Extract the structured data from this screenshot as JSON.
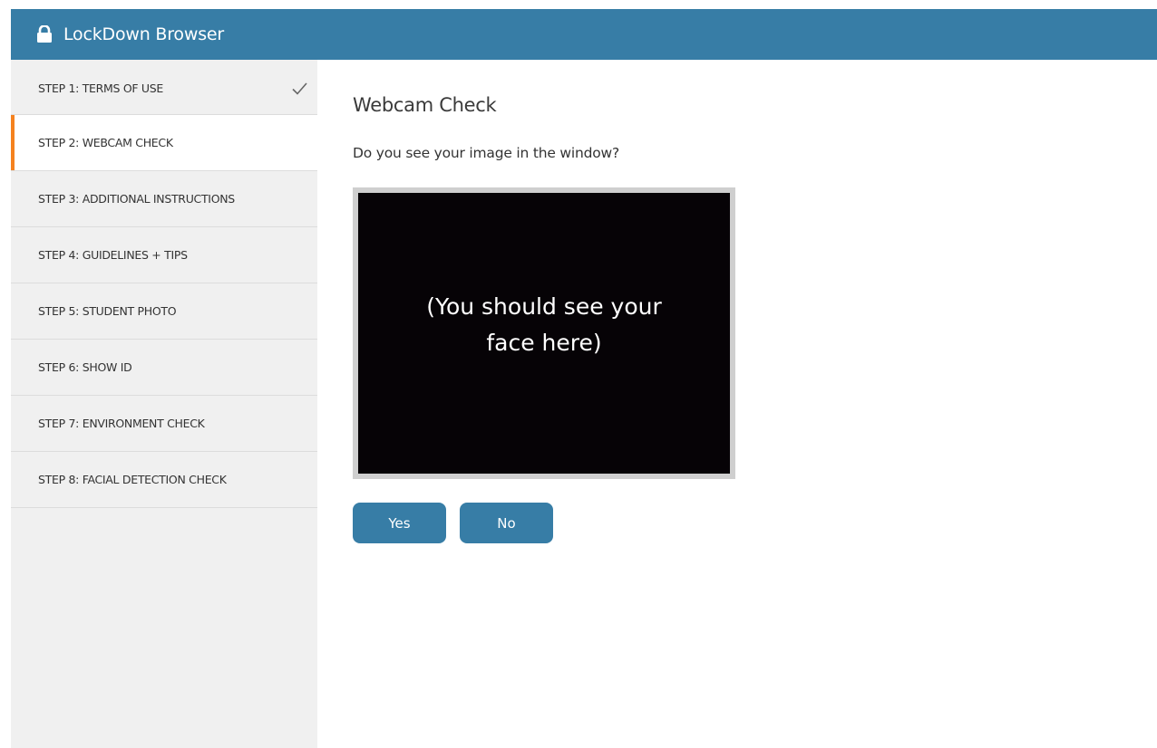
{
  "app": {
    "title": "LockDown Browser",
    "icon": "lock-icon",
    "accent": "#377da6",
    "active_marker": "#f5821f"
  },
  "sidebar": {
    "steps": [
      {
        "label": "STEP 1: TERMS OF USE",
        "completed": true,
        "active": false
      },
      {
        "label": "STEP 2: WEBCAM CHECK",
        "completed": false,
        "active": true
      },
      {
        "label": "STEP 3: ADDITIONAL INSTRUCTIONS",
        "completed": false,
        "active": false
      },
      {
        "label": "STEP 4: GUIDELINES + TIPS",
        "completed": false,
        "active": false
      },
      {
        "label": "STEP 5: STUDENT PHOTO",
        "completed": false,
        "active": false
      },
      {
        "label": "STEP 6: SHOW ID",
        "completed": false,
        "active": false
      },
      {
        "label": "STEP 7: ENVIRONMENT CHECK",
        "completed": false,
        "active": false
      },
      {
        "label": "STEP 8: FACIAL DETECTION CHECK",
        "completed": false,
        "active": false
      }
    ]
  },
  "main": {
    "heading": "Webcam Check",
    "question": "Do you see your image in the window?",
    "webcam_placeholder": "(You should see your face here)",
    "yes_label": "Yes",
    "no_label": "No"
  }
}
